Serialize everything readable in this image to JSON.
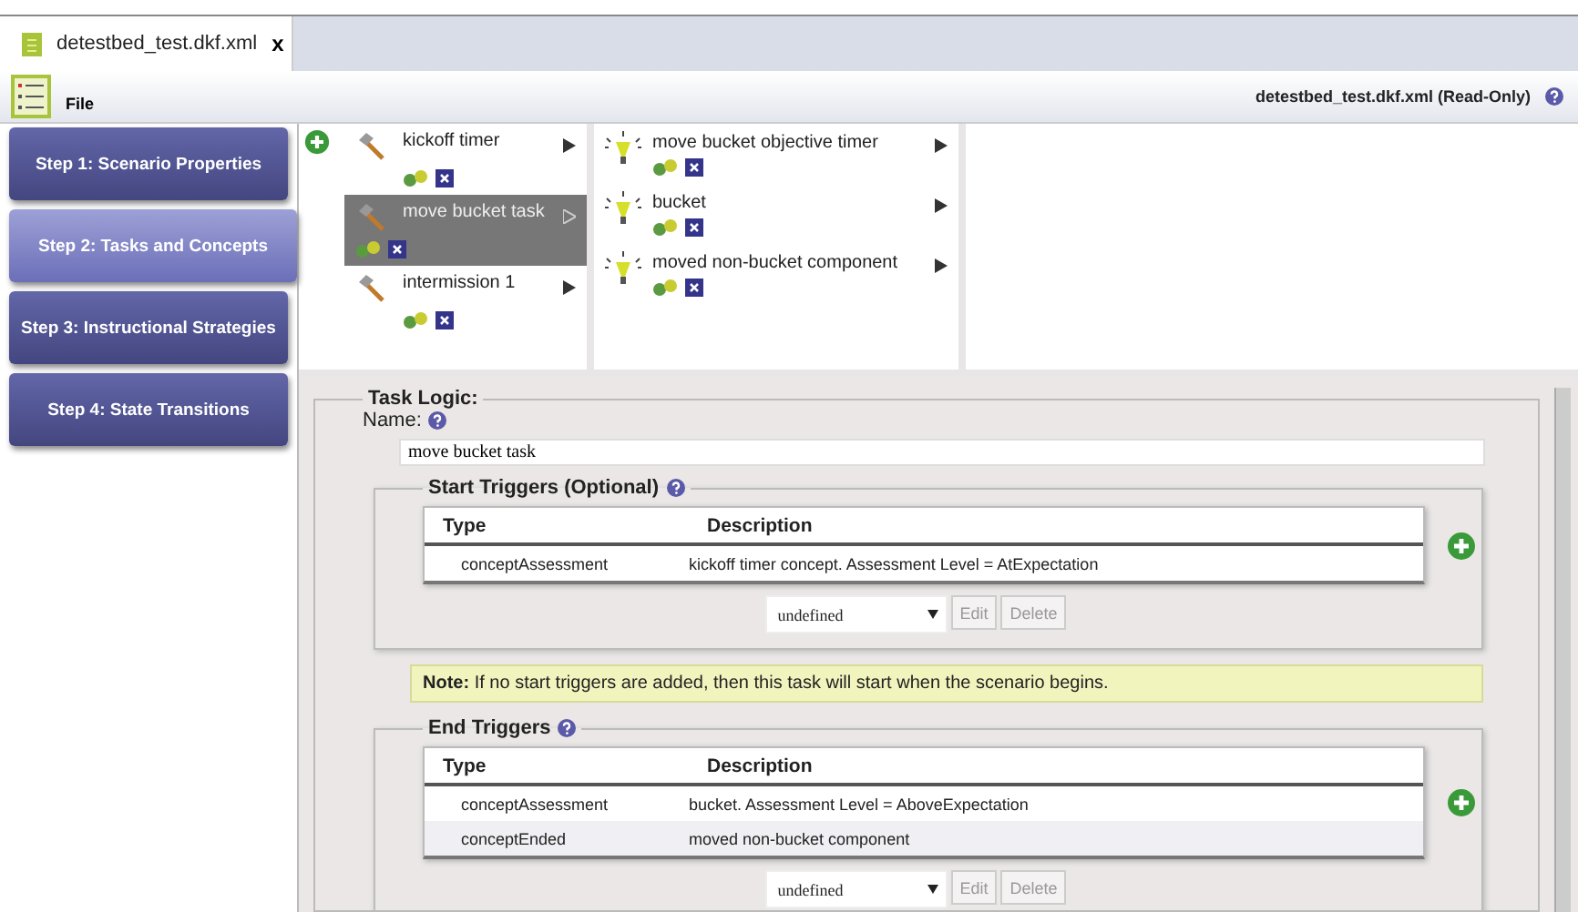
{
  "tab": {
    "title": "detestbed_test.dkf.xml",
    "close": "x"
  },
  "toolbar": {
    "menu": "File",
    "file_status": "detestbed_test.dkf.xml (Read-Only)"
  },
  "steps": [
    {
      "label": "Step 1: Scenario Properties",
      "selected": false
    },
    {
      "label": "Step 2: Tasks and Concepts",
      "selected": true
    },
    {
      "label": "Step 3: Instructional Strategies",
      "selected": false
    },
    {
      "label": "Step 4: State Transitions",
      "selected": false
    }
  ],
  "tasks": [
    {
      "name": "kickoff timer",
      "selected": false
    },
    {
      "name": "move bucket task",
      "selected": true
    },
    {
      "name": "intermission 1",
      "selected": false
    }
  ],
  "concepts": [
    {
      "name": "move bucket objective timer"
    },
    {
      "name": "bucket"
    },
    {
      "name": "moved non-bucket component"
    }
  ],
  "task_logic": {
    "legend": "Task Logic:",
    "name_label": "Name:",
    "name_value": "move bucket task",
    "start_triggers": {
      "legend": "Start Triggers (Optional)",
      "columns": [
        "Type",
        "Description"
      ],
      "rows": [
        [
          "conceptAssessment",
          "kickoff timer concept. Assessment Level = AtExpectation"
        ]
      ],
      "select": "undefined",
      "buttons": [
        "Edit",
        "Delete"
      ]
    },
    "note": {
      "label": "Note:",
      "text": "If no start triggers are added, then this task will start when the scenario begins."
    },
    "end_triggers": {
      "legend": "End Triggers",
      "columns": [
        "Type",
        "Description"
      ],
      "rows": [
        [
          "conceptAssessment",
          "bucket. Assessment Level = AboveExpectation"
        ],
        [
          "conceptEnded",
          "moved non-bucket component"
        ]
      ],
      "select": "undefined",
      "buttons": [
        "Edit",
        "Delete"
      ]
    }
  }
}
